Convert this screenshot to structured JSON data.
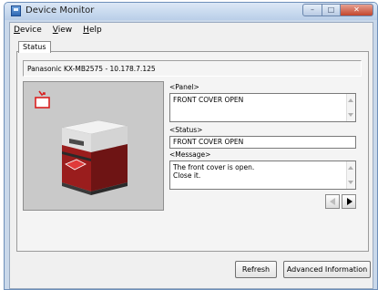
{
  "window": {
    "title": "Device Monitor",
    "icon": "app-icon",
    "controls": {
      "minimize": "–",
      "maximize": "□",
      "close": "✕"
    }
  },
  "menu": {
    "items": [
      {
        "label": "Device"
      },
      {
        "label": "View"
      },
      {
        "label": "Help"
      }
    ]
  },
  "tabs": [
    {
      "label": "Status"
    }
  ],
  "device": {
    "label": "Panasonic KX-MB2575 - 10.178.7.125"
  },
  "panel": {
    "label": "<Panel>",
    "text": "FRONT COVER OPEN"
  },
  "status": {
    "label": "<Status>",
    "text": "FRONT COVER OPEN"
  },
  "message": {
    "label": "<Message>",
    "lines": [
      "The front cover is open.",
      "Close it."
    ]
  },
  "buttons": {
    "refresh": "Refresh",
    "advanced": "Advanced Information"
  },
  "colors": {
    "title_bar": "#b9cee8",
    "close_button": "#c2442c",
    "printer_body": "#8b1a1a",
    "alert": "#d92020"
  }
}
